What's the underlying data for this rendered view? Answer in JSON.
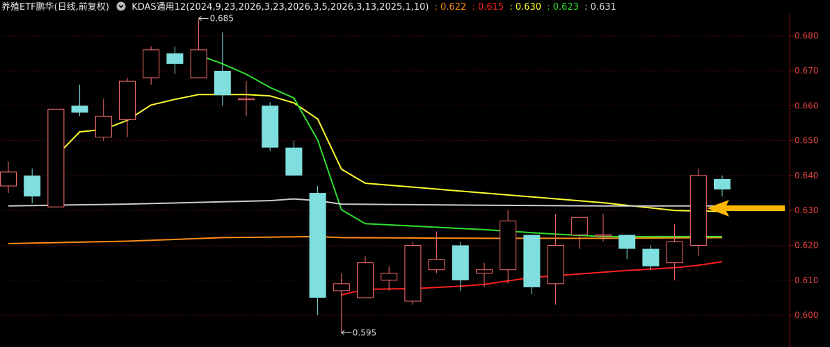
{
  "header": {
    "title": "养殖ETF鹏华(日线,前复权)",
    "indicator_label": "KDAS通用12(2024,9,23,2026,3,23,2026,3,5,2026,3,13,2025,1,10)",
    "values": [
      {
        "text": ": 0.622",
        "color": "#ff8c1a"
      },
      {
        "text": ": 0.615",
        "color": "#ff2020"
      },
      {
        "text": ": 0.630",
        "color": "#ffff30"
      },
      {
        "text": ": 0.623",
        "color": "#30e030"
      },
      {
        "text": ": 0.631",
        "color": "#dddddd"
      }
    ]
  },
  "colors": {
    "background": "#000000",
    "up": "#ff6f6f",
    "down": "#7fdede",
    "grid": "#7a1010",
    "axis_label": "#e04040",
    "arrow": "#ffb800"
  },
  "chart_data": {
    "type": "candlestick",
    "ylim": [
      0.595,
      0.687
    ],
    "yticks": [
      "0.680",
      "0.670",
      "0.660",
      "0.650",
      "0.640",
      "0.630",
      "0.620",
      "0.610",
      "0.600"
    ],
    "candles": [
      {
        "o": 0.637,
        "c": 0.641,
        "h": 0.644,
        "l": 0.635
      },
      {
        "o": 0.64,
        "c": 0.634,
        "h": 0.642,
        "l": 0.632
      },
      {
        "o": 0.631,
        "c": 0.659,
        "h": 0.659,
        "l": 0.631
      },
      {
        "o": 0.66,
        "c": 0.658,
        "h": 0.666,
        "l": 0.657
      },
      {
        "o": 0.651,
        "c": 0.657,
        "h": 0.662,
        "l": 0.65
      },
      {
        "o": 0.656,
        "c": 0.667,
        "h": 0.668,
        "l": 0.651
      },
      {
        "o": 0.668,
        "c": 0.676,
        "h": 0.677,
        "l": 0.666
      },
      {
        "o": 0.675,
        "c": 0.672,
        "h": 0.677,
        "l": 0.669
      },
      {
        "o": 0.668,
        "c": 0.676,
        "h": 0.685,
        "l": 0.668
      },
      {
        "o": 0.67,
        "c": 0.663,
        "h": 0.681,
        "l": 0.66
      },
      {
        "o": 0.662,
        "c": 0.662,
        "h": 0.667,
        "l": 0.657
      },
      {
        "o": 0.66,
        "c": 0.648,
        "h": 0.661,
        "l": 0.647
      },
      {
        "o": 0.648,
        "c": 0.64,
        "h": 0.65,
        "l": 0.64
      },
      {
        "o": 0.635,
        "c": 0.605,
        "h": 0.637,
        "l": 0.6
      },
      {
        "o": 0.607,
        "c": 0.609,
        "h": 0.612,
        "l": 0.595
      },
      {
        "o": 0.605,
        "c": 0.615,
        "h": 0.617,
        "l": 0.605
      },
      {
        "o": 0.61,
        "c": 0.612,
        "h": 0.614,
        "l": 0.607
      },
      {
        "o": 0.604,
        "c": 0.62,
        "h": 0.621,
        "l": 0.603
      },
      {
        "o": 0.613,
        "c": 0.616,
        "h": 0.624,
        "l": 0.612
      },
      {
        "o": 0.62,
        "c": 0.61,
        "h": 0.621,
        "l": 0.607
      },
      {
        "o": 0.612,
        "c": 0.613,
        "h": 0.615,
        "l": 0.608
      },
      {
        "o": 0.613,
        "c": 0.627,
        "h": 0.63,
        "l": 0.609
      },
      {
        "o": 0.623,
        "c": 0.608,
        "h": 0.623,
        "l": 0.606
      },
      {
        "o": 0.609,
        "c": 0.62,
        "h": 0.629,
        "l": 0.603
      },
      {
        "o": 0.623,
        "c": 0.628,
        "h": 0.628,
        "l": 0.619
      },
      {
        "o": 0.623,
        "c": 0.623,
        "h": 0.629,
        "l": 0.621
      },
      {
        "o": 0.623,
        "c": 0.619,
        "h": 0.623,
        "l": 0.616
      },
      {
        "o": 0.619,
        "c": 0.614,
        "h": 0.62,
        "l": 0.613
      },
      {
        "o": 0.615,
        "c": 0.621,
        "h": 0.626,
        "l": 0.61
      },
      {
        "o": 0.62,
        "c": 0.64,
        "h": 0.642,
        "l": 0.617
      },
      {
        "o": 0.639,
        "c": 0.636,
        "h": 0.64,
        "l": 0.634
      }
    ],
    "series": [
      {
        "color": "#ff8c1a",
        "points": [
          [
            0,
            0.6205
          ],
          [
            5,
            0.6212
          ],
          [
            9,
            0.6222
          ],
          [
            13,
            0.6225
          ],
          [
            14,
            0.6222
          ],
          [
            20,
            0.622
          ],
          [
            25,
            0.622
          ],
          [
            30,
            0.6222
          ]
        ]
      },
      {
        "color": "#ff2020",
        "points": [
          [
            14,
            0.6058
          ],
          [
            15,
            0.6074
          ],
          [
            17,
            0.6076
          ],
          [
            19,
            0.6083
          ],
          [
            20,
            0.6088
          ],
          [
            21,
            0.6098
          ],
          [
            22,
            0.6108
          ],
          [
            24,
            0.6118
          ],
          [
            26,
            0.6128
          ],
          [
            28,
            0.6136
          ],
          [
            29,
            0.6143
          ],
          [
            30,
            0.6153
          ]
        ]
      },
      {
        "color": "#ffff30",
        "points": [
          [
            2,
            0.6455
          ],
          [
            3,
            0.6525
          ],
          [
            4,
            0.6532
          ],
          [
            5,
            0.6558
          ],
          [
            6,
            0.6602
          ],
          [
            7,
            0.6618
          ],
          [
            8,
            0.6632
          ],
          [
            9,
            0.6632
          ],
          [
            10,
            0.6632
          ],
          [
            11,
            0.6628
          ],
          [
            12,
            0.6608
          ],
          [
            13,
            0.6562
          ],
          [
            14,
            0.6418
          ],
          [
            15,
            0.6378
          ],
          [
            20,
            0.635
          ],
          [
            25,
            0.6322
          ],
          [
            28,
            0.63
          ],
          [
            30,
            0.6297
          ]
        ]
      },
      {
        "color": "#30e030",
        "points": [
          [
            8,
            0.6745
          ],
          [
            9,
            0.672
          ],
          [
            10,
            0.669
          ],
          [
            11,
            0.6652
          ],
          [
            12,
            0.6622
          ],
          [
            13,
            0.6502
          ],
          [
            14,
            0.6302
          ],
          [
            15,
            0.6262
          ],
          [
            20,
            0.6245
          ],
          [
            23,
            0.6232
          ],
          [
            25,
            0.6225
          ],
          [
            30,
            0.6225
          ]
        ]
      },
      {
        "color": "#cccccc",
        "points": [
          [
            0,
            0.6313
          ],
          [
            5,
            0.6318
          ],
          [
            11,
            0.6328
          ],
          [
            12,
            0.6333
          ],
          [
            13,
            0.6328
          ],
          [
            14,
            0.6318
          ],
          [
            20,
            0.6315
          ],
          [
            25,
            0.6313
          ],
          [
            30,
            0.6313
          ]
        ]
      }
    ],
    "annotations": [
      {
        "text": "0.685",
        "candle": 8,
        "value": 0.685
      },
      {
        "text": "0.595",
        "candle": 14,
        "value": 0.595
      }
    ]
  }
}
